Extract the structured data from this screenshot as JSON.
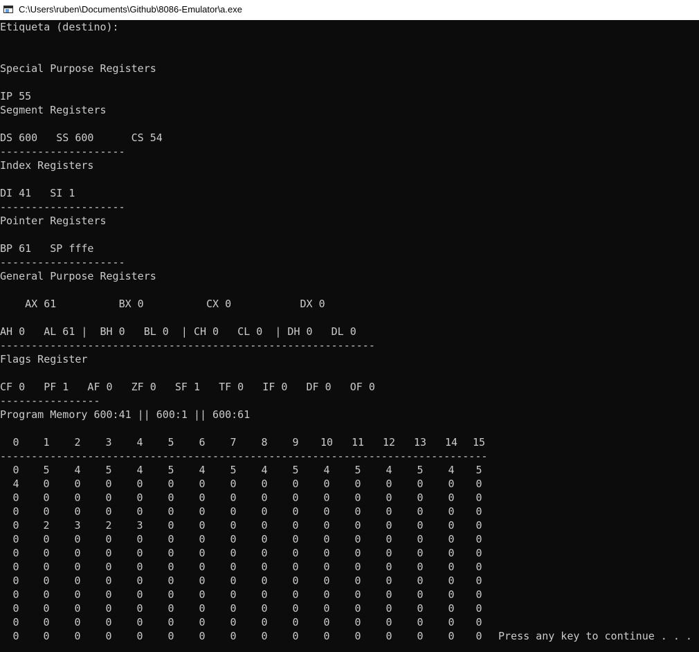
{
  "window": {
    "title": "C:\\Users\\ruben\\Documents\\Github\\8086-Emulator\\a.exe",
    "icon": "console-window-icon"
  },
  "lines": [
    "Etiqueta (destino):",
    "",
    "",
    "Special Purpose Registers",
    "",
    "IP 55",
    "Segment Registers",
    "",
    "DS 600   SS 600      CS 54",
    "--------------------",
    "Index Registers",
    "",
    "DI 41   SI 1",
    "--------------------",
    "Pointer Registers",
    "",
    "BP 61   SP fffe",
    "--------------------",
    "General Purpose Registers",
    "",
    "    AX 61          BX 0          CX 0           DX 0",
    "",
    "AH 0   AL 61 |  BH 0   BL 0  | CH 0   CL 0  | DH 0   DL 0",
    "------------------------------------------------------------",
    "Flags Register",
    "",
    "CF 0   PF 1   AF 0   ZF 0   SF 1   TF 0   IF 0   DF 0   OF 0",
    "----------------",
    "Program Memory 600:41 || 600:1 || 600:61",
    "",
    "",
    "------------------------------------------------------------------------------"
  ],
  "memory": {
    "columns": [
      "0",
      "1",
      "2",
      "3",
      "4",
      "5",
      "6",
      "7",
      "8",
      "9",
      "10",
      "11",
      "12",
      "13",
      "14",
      "15"
    ],
    "rows": [
      [
        "0",
        "5",
        "4",
        "5",
        "4",
        "5",
        "4",
        "5",
        "4",
        "5",
        "4",
        "5",
        "4",
        "5",
        "4",
        "5"
      ],
      [
        "4",
        "0",
        "0",
        "0",
        "0",
        "0",
        "0",
        "0",
        "0",
        "0",
        "0",
        "0",
        "0",
        "0",
        "0",
        "0"
      ],
      [
        "0",
        "0",
        "0",
        "0",
        "0",
        "0",
        "0",
        "0",
        "0",
        "0",
        "0",
        "0",
        "0",
        "0",
        "0",
        "0"
      ],
      [
        "0",
        "0",
        "0",
        "0",
        "0",
        "0",
        "0",
        "0",
        "0",
        "0",
        "0",
        "0",
        "0",
        "0",
        "0",
        "0"
      ],
      [
        "0",
        "2",
        "3",
        "2",
        "3",
        "0",
        "0",
        "0",
        "0",
        "0",
        "0",
        "0",
        "0",
        "0",
        "0",
        "0"
      ],
      [
        "0",
        "0",
        "0",
        "0",
        "0",
        "0",
        "0",
        "0",
        "0",
        "0",
        "0",
        "0",
        "0",
        "0",
        "0",
        "0"
      ],
      [
        "0",
        "0",
        "0",
        "0",
        "0",
        "0",
        "0",
        "0",
        "0",
        "0",
        "0",
        "0",
        "0",
        "0",
        "0",
        "0"
      ],
      [
        "0",
        "0",
        "0",
        "0",
        "0",
        "0",
        "0",
        "0",
        "0",
        "0",
        "0",
        "0",
        "0",
        "0",
        "0",
        "0"
      ],
      [
        "0",
        "0",
        "0",
        "0",
        "0",
        "0",
        "0",
        "0",
        "0",
        "0",
        "0",
        "0",
        "0",
        "0",
        "0",
        "0"
      ],
      [
        "0",
        "0",
        "0",
        "0",
        "0",
        "0",
        "0",
        "0",
        "0",
        "0",
        "0",
        "0",
        "0",
        "0",
        "0",
        "0"
      ],
      [
        "0",
        "0",
        "0",
        "0",
        "0",
        "0",
        "0",
        "0",
        "0",
        "0",
        "0",
        "0",
        "0",
        "0",
        "0",
        "0"
      ],
      [
        "0",
        "0",
        "0",
        "0",
        "0",
        "0",
        "0",
        "0",
        "0",
        "0",
        "0",
        "0",
        "0",
        "0",
        "0",
        "0"
      ],
      [
        "0",
        "0",
        "0",
        "0",
        "0",
        "0",
        "0",
        "0",
        "0",
        "0",
        "0",
        "0",
        "0",
        "0",
        "0",
        "0"
      ]
    ]
  },
  "prompt": "Press any key to continue . . .",
  "colors": {
    "background": "#0c0c0c",
    "text": "#cccccc",
    "titlebar": "#ffffff"
  }
}
